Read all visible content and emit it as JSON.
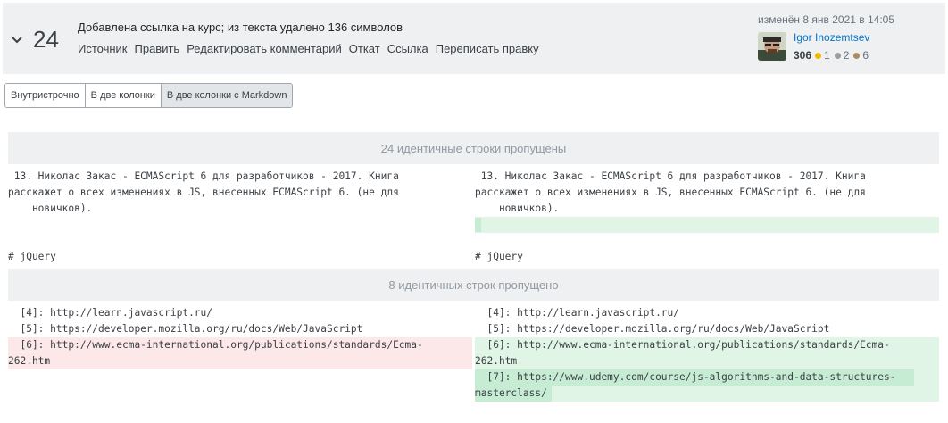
{
  "revision": {
    "number": "24",
    "summary": "Добавлена ссылка на курс; из текста удалено 136 символов",
    "links": [
      "Источник",
      "Править",
      "Редактировать комментарий",
      "Откат",
      "Ссылка",
      "Переписать правку"
    ],
    "edited": "изменён 8 янв 2021 в 14:05"
  },
  "user": {
    "name": "Igor Inozemtsev",
    "reputation": "306",
    "badges": {
      "gold": "1",
      "silver": "2",
      "bronze": "6",
      "gold_color": "#f1b600",
      "silver_color": "#9a9c9f",
      "bronze_color": "#ab8a5f"
    }
  },
  "view_modes": [
    "Внутристрочно",
    "В две колонки",
    "В две колонки с Markdown"
  ],
  "diff": {
    "skip1": "24 идентичные строки пропущены",
    "skip2": "8 идентичных строк пропущено",
    "left": {
      "block1": [
        " 13. Николас Закас - ECMAScript 6 для разработчиков - 2017. Книга",
        "расскажет о всех изменениях в JS, внесенных ECMAScript 6. (не для",
        "    новичков)."
      ],
      "heading": "# jQuery",
      "links": [
        "  [4]: http://learn.javascript.ru/",
        "  [5]: https://developer.mozilla.org/ru/docs/Web/JavaScript",
        "  [6]: http://www.ecma-international.org/publications/standards/Ecma-",
        "262.htm"
      ]
    },
    "right": {
      "block1": [
        " 13. Николас Закас - ECMAScript 6 для разработчиков - 2017. Книга",
        "расскажет о всех изменениях в JS, внесенных ECMAScript 6. (не для",
        "    новичков)."
      ],
      "heading": "# jQuery",
      "links": [
        "  [4]: http://learn.javascript.ru/",
        "  [5]: https://developer.mozilla.org/ru/docs/Web/JavaScript",
        "  [6]: http://www.ecma-international.org/publications/standards/Ecma-",
        "262.htm",
        "  [7]: https://www.udemy.com/course/js-algorithms-and-data-structures-",
        "masterclass/"
      ]
    }
  }
}
